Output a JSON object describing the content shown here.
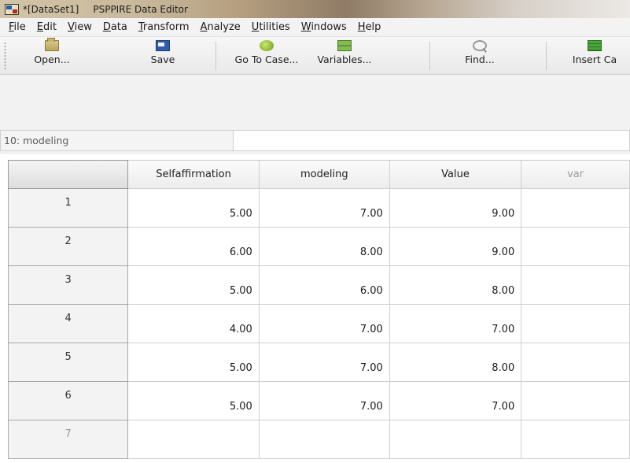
{
  "window": {
    "dataset": "*[DataSet1]",
    "app_title": "PSPPIRE Data Editor"
  },
  "menu": [
    {
      "first": "F",
      "rest": "ile"
    },
    {
      "first": "E",
      "rest": "dit"
    },
    {
      "first": "V",
      "rest": "iew"
    },
    {
      "first": "D",
      "rest": "ata"
    },
    {
      "first": "T",
      "rest": "ransform"
    },
    {
      "first": "A",
      "rest": "nalyze"
    },
    {
      "first": "U",
      "rest": "tilities"
    },
    {
      "first": "W",
      "rest": "indows"
    },
    {
      "first": "H",
      "rest": "elp"
    }
  ],
  "toolbar": {
    "open": "Open...",
    "save": "Save",
    "goto_case": "Go To Case...",
    "variables": "Variables...",
    "find": "Find...",
    "insert_case": "Insert Ca"
  },
  "cell_ref": {
    "label": "10: modeling",
    "value": ""
  },
  "grid": {
    "columns": [
      "Selfaffirmation",
      "modeling",
      "Value",
      "var"
    ],
    "rows": [
      {
        "num": "1",
        "cells": [
          "5.00",
          "7.00",
          "9.00",
          ""
        ]
      },
      {
        "num": "2",
        "cells": [
          "6.00",
          "8.00",
          "9.00",
          ""
        ]
      },
      {
        "num": "3",
        "cells": [
          "5.00",
          "6.00",
          "8.00",
          ""
        ]
      },
      {
        "num": "4",
        "cells": [
          "4.00",
          "7.00",
          "7.00",
          ""
        ]
      },
      {
        "num": "5",
        "cells": [
          "5.00",
          "7.00",
          "8.00",
          ""
        ]
      },
      {
        "num": "6",
        "cells": [
          "5.00",
          "7.00",
          "7.00",
          ""
        ]
      },
      {
        "num": "7",
        "cells": [
          "",
          "",
          "",
          ""
        ]
      }
    ]
  }
}
